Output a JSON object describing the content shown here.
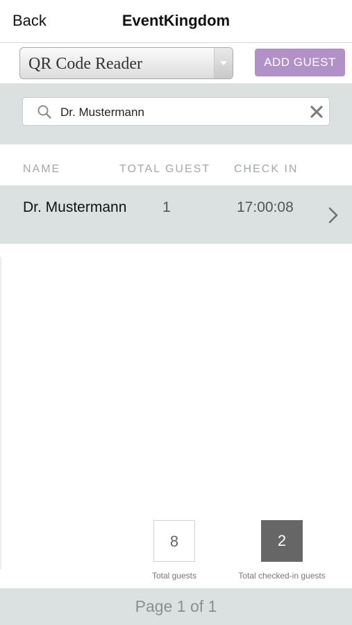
{
  "nav": {
    "back_label": "Back",
    "title": "EventKingdom"
  },
  "toolbar": {
    "mode_selected": "QR Code Reader",
    "add_guest_label": "ADD GUEST"
  },
  "search": {
    "value": "Dr. Mustermann"
  },
  "table": {
    "headers": [
      "NAME",
      "TOTAL GUEST",
      "CHECK IN"
    ],
    "rows": [
      {
        "name": "Dr. Mustermann",
        "total_guest": "1",
        "check_in": "17:00:08"
      }
    ]
  },
  "stats": {
    "total_guests": {
      "value": "8",
      "label": "Total guests"
    },
    "checked_in": {
      "value": "2",
      "label": "Total checked-in guests"
    }
  },
  "pagination": {
    "text": "Page 1 of 1"
  },
  "colors": {
    "accent": "#b291c9",
    "panel": "#dbe1e1",
    "checked_in_box": "#666666"
  },
  "icons": {
    "search": "search-icon",
    "clear": "clear-icon",
    "row_chevron": "chevron-right-icon",
    "select_arrow": "chevron-down-icon"
  }
}
